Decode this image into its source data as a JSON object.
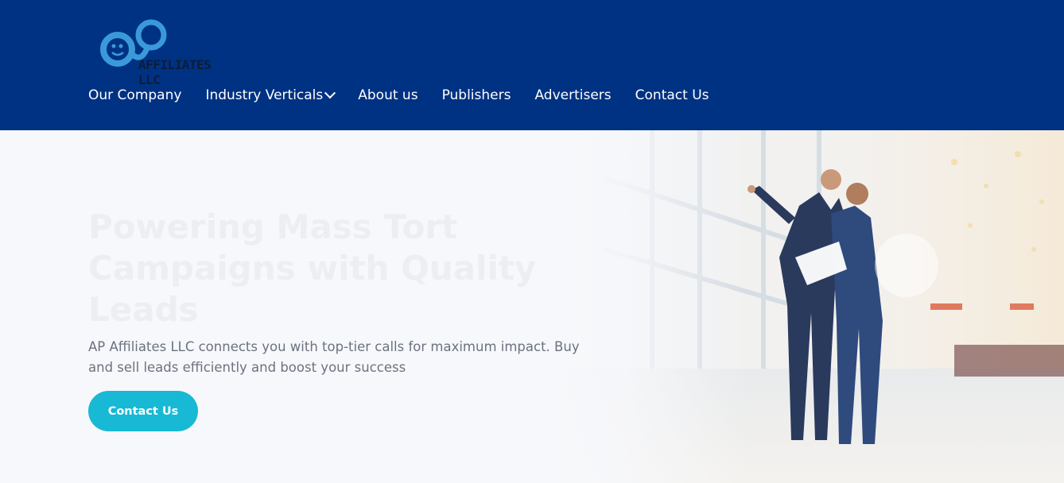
{
  "brand": {
    "logo_text": "AFFILIATES LLC",
    "colors": {
      "header_bg": "#003283",
      "logo_blue": "#3a9ad9",
      "cta": "#17b9d4"
    }
  },
  "nav": {
    "items": [
      {
        "label": "Our Company"
      },
      {
        "label": "Industry Verticals",
        "has_dropdown": true
      },
      {
        "label": "About us"
      },
      {
        "label": "Publishers"
      },
      {
        "label": "Advertisers"
      },
      {
        "label": "Contact Us"
      }
    ]
  },
  "hero": {
    "headline": "Powering Mass Tort Campaigns with Quality Leads",
    "subtext": "AP Affiliates LLC connects you with top-tier calls for maximum impact. Buy and sell leads efficiently and boost your success",
    "cta_label": "Contact Us"
  }
}
